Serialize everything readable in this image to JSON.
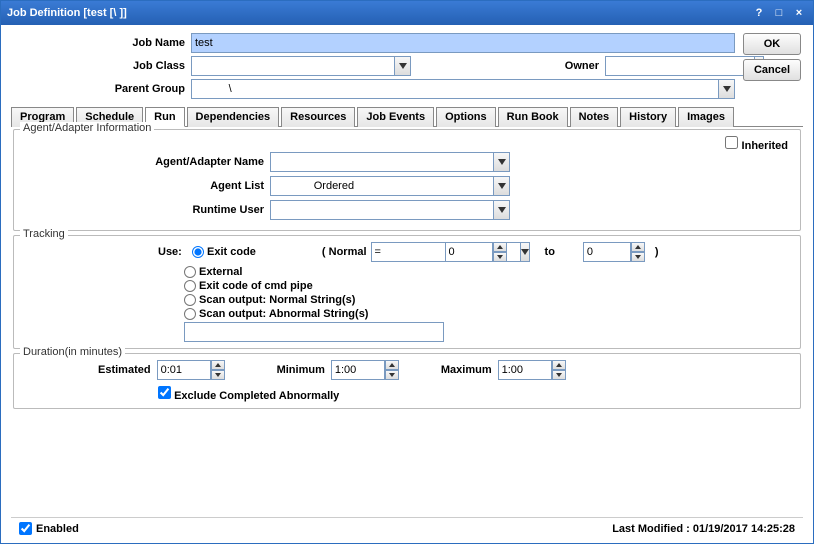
{
  "window": {
    "title": "Job Definition [test             [\\                     ]]"
  },
  "buttons": {
    "ok": "OK",
    "cancel": "Cancel"
  },
  "form": {
    "jobName": {
      "label": "Job Name",
      "value": "test"
    },
    "jobClass": {
      "label": "Job Class",
      "value": ""
    },
    "owner": {
      "label": "Owner",
      "value": ""
    },
    "parentGroup": {
      "label": "Parent Group",
      "value": "           \\"
    }
  },
  "tabs": [
    "Program",
    "Schedule",
    "Run",
    "Dependencies",
    "Resources",
    "Job Events",
    "Options",
    "Run Book",
    "Notes",
    "History",
    "Images"
  ],
  "activeTab": "Run",
  "agent": {
    "legend": "Agent/Adapter Information",
    "inherited": "Inherited",
    "name": {
      "label": "Agent/Adapter Name",
      "value": ""
    },
    "list": {
      "label": "Agent List",
      "value": "             Ordered"
    },
    "runtimeUser": {
      "label": "Runtime User",
      "value": ""
    }
  },
  "tracking": {
    "legend": "Tracking",
    "useLabel": "Use:",
    "options": {
      "exitCode": "Exit code",
      "external": "External",
      "exitCodeCmd": "Exit code of cmd pipe",
      "scanNormal": "Scan output: Normal String(s)",
      "scanAbnormal": "Scan output: Abnormal String(s)"
    },
    "normal": {
      "label": "( Normal",
      "op": "=",
      "from": "0",
      "to": "to",
      "toVal": "0",
      "close": ")"
    },
    "scanInput": ""
  },
  "duration": {
    "legend": "Duration(in minutes)",
    "estimated": {
      "label": "Estimated",
      "value": "0:01"
    },
    "minimum": {
      "label": "Minimum",
      "value": "1:00"
    },
    "maximum": {
      "label": "Maximum",
      "value": "1:00"
    },
    "exclude": "Exclude Completed Abnormally"
  },
  "footer": {
    "enabled": "Enabled",
    "modified": "Last Modified : 01/19/2017 14:25:28"
  }
}
